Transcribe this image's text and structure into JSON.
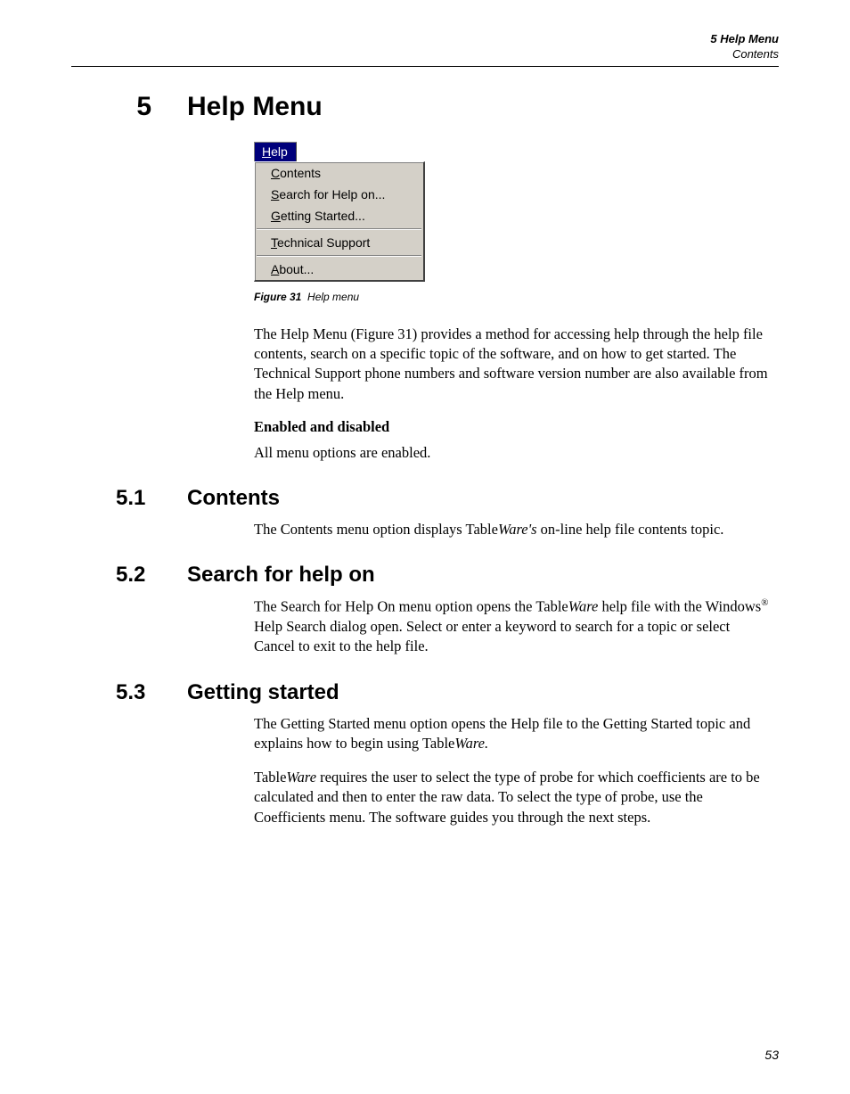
{
  "header": {
    "title": "5  Help Menu",
    "subtitle": "Contents"
  },
  "chapter": {
    "num": "5",
    "title": "Help Menu"
  },
  "menu": {
    "help_label_pre": "H",
    "help_label_rest": "elp",
    "items": {
      "contents_u": "C",
      "contents_rest": "ontents",
      "search_u": "S",
      "search_rest": "earch for Help on...",
      "getting_u": "G",
      "getting_rest": "etting Started...",
      "tech_u": "T",
      "tech_rest": "echnical Support",
      "about_u": "A",
      "about_rest": "bout..."
    }
  },
  "figure": {
    "label": "Figure 31",
    "caption": "Help menu"
  },
  "intro_para": "The Help Menu (Figure 31) provides a method for accessing help through the help file contents, search on a specific topic of the software, and on how to get started. The Technical Support phone numbers and software version number are also available from the Help menu.",
  "enabled_heading": "Enabled and disabled",
  "enabled_text": "All menu options are enabled.",
  "section51": {
    "num": "5.1",
    "title": "Contents",
    "para_pre": "The Contents menu option displays Table",
    "para_ware": "Ware's",
    "para_post": " on-line help file contents topic."
  },
  "section52": {
    "num": "5.2",
    "title": "Search for help on",
    "para_pre": "The Search for Help On menu option opens the Table",
    "para_ware": "Ware",
    "para_mid": " help file with the Windows",
    "para_post": " Help Search dialog open. Select or enter a keyword to search for a topic or select Cancel to exit to the help file."
  },
  "section53": {
    "num": "5.3",
    "title": "Getting started",
    "para1_pre": "The Getting Started menu option opens the Help file to the Getting Started topic and explains how to begin using Table",
    "para1_ware": "Ware.",
    "para2_pre": "Table",
    "para2_ware": "Ware",
    "para2_post": " requires the user to select the type of probe for which coefficients are to be calculated and then to enter the raw data. To select the type of probe, use the Coefficients menu. The software guides you through the next steps."
  },
  "page_number": "53"
}
